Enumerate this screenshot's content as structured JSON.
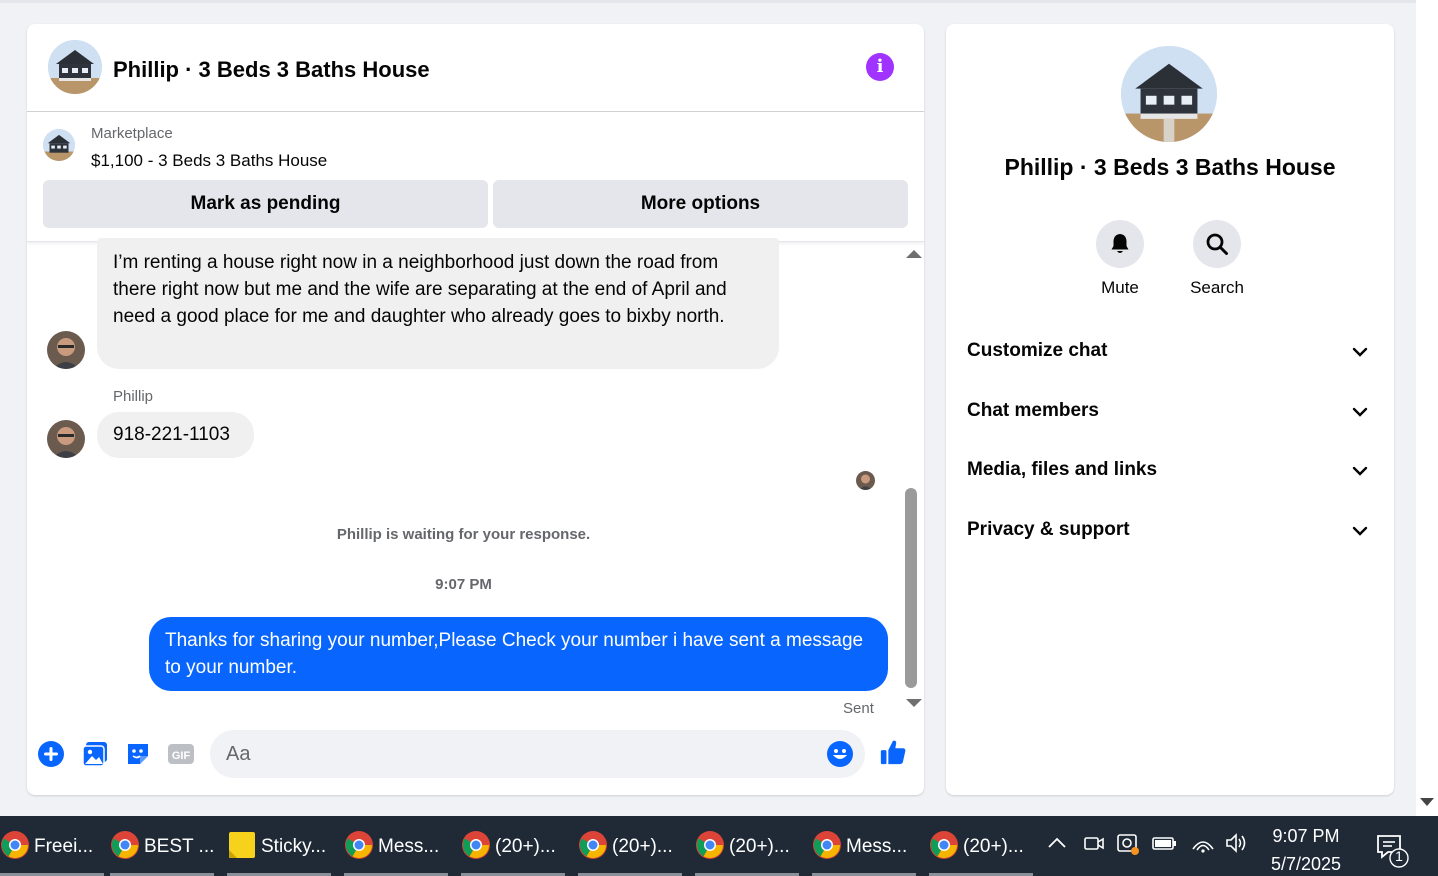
{
  "chat": {
    "title": "Phillip · 3 Beds 3 Baths House",
    "marketplace_label": "Marketplace",
    "listing_title": "$1,100 - 3 Beds 3 Baths House",
    "mark_pending_label": "Mark as pending",
    "more_options_label": "More options",
    "messages": [
      {
        "sender": "Phillip",
        "text": "I’m renting a house right now in a neighborhood just down the road from there right now but me and the wife are separating at the end of April and need a good place for me and daughter who already goes to bixby north."
      },
      {
        "sender": "Phillip",
        "sender_label": "Phillip",
        "text": "918-221-1103"
      },
      {
        "sender": "me",
        "text": "Thanks for sharing your number,Please Check your number i have sent a message to your number."
      }
    ],
    "waiting_notice": "Phillip is waiting for your response.",
    "timestamp": "9:07 PM",
    "sent_status": "Sent",
    "composer_placeholder": "Aa"
  },
  "sidebar": {
    "title": "Phillip · 3 Beds 3 Baths House",
    "actions": [
      {
        "label": "Mute",
        "icon": "bell-icon"
      },
      {
        "label": "Search",
        "icon": "search-icon"
      }
    ],
    "sections": [
      {
        "label": "Customize chat"
      },
      {
        "label": "Chat members"
      },
      {
        "label": "Media, files and links"
      },
      {
        "label": "Privacy & support"
      }
    ]
  },
  "taskbar": {
    "apps": [
      {
        "label": "Freei...",
        "icon": "chrome-icon"
      },
      {
        "label": "BEST ...",
        "icon": "chrome-icon"
      },
      {
        "label": "Sticky...",
        "icon": "sticky-notes-icon"
      },
      {
        "label": "Mess...",
        "icon": "chrome-icon"
      },
      {
        "label": "(20+)...",
        "icon": "chrome-icon"
      },
      {
        "label": "(20+)...",
        "icon": "chrome-icon"
      },
      {
        "label": "(20+)...",
        "icon": "chrome-icon"
      },
      {
        "label": "Mess...",
        "icon": "chrome-icon"
      },
      {
        "label": "(20+)...",
        "icon": "chrome-icon"
      }
    ],
    "time": "9:07 PM",
    "date": "5/7/2025",
    "notification_count": "1"
  },
  "colors": {
    "accent_blue": "#0866ff",
    "info_purple": "#a033ff",
    "taskbar_bg": "#1f2a36"
  }
}
